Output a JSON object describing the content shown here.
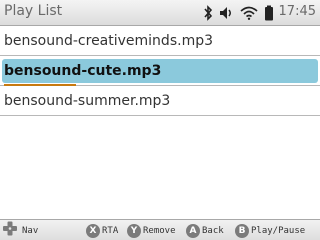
{
  "title": "Play List",
  "status": {
    "icons": [
      "bluetooth-icon",
      "volume-icon",
      "wifi-icon",
      "battery-icon"
    ],
    "time": "17:45"
  },
  "playlist": {
    "items": [
      {
        "label": "bensound-creativeminds.mp3",
        "selected": false
      },
      {
        "label": "bensound-cute.mp3",
        "selected": true
      },
      {
        "label": "bensound-summer.mp3",
        "selected": false
      }
    ],
    "selected_progress": 0.23
  },
  "footer": {
    "nav_label": "Nav",
    "x": {
      "button": "X",
      "label": "RTA"
    },
    "y": {
      "button": "Y",
      "label": "Remove"
    },
    "a": {
      "button": "A",
      "label": "Back"
    },
    "b": {
      "button": "B",
      "label": "Play/Pause"
    }
  },
  "colors": {
    "selection": "#8bc9dc",
    "progress": "#c87a10",
    "button": "#7b7b7b"
  }
}
